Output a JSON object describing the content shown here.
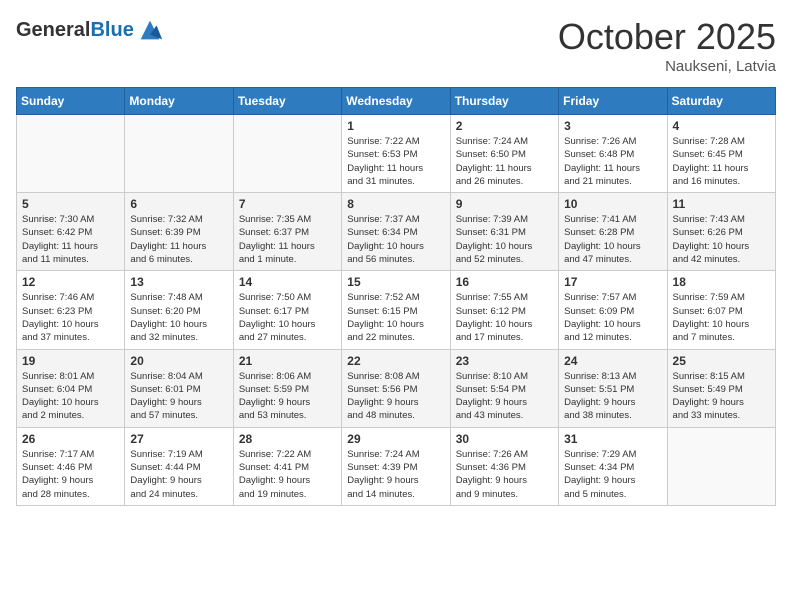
{
  "header": {
    "logo_line1": "General",
    "logo_line2": "Blue",
    "month": "October 2025",
    "location": "Naukseni, Latvia"
  },
  "weekdays": [
    "Sunday",
    "Monday",
    "Tuesday",
    "Wednesday",
    "Thursday",
    "Friday",
    "Saturday"
  ],
  "weeks": [
    [
      {
        "day": "",
        "info": ""
      },
      {
        "day": "",
        "info": ""
      },
      {
        "day": "",
        "info": ""
      },
      {
        "day": "1",
        "info": "Sunrise: 7:22 AM\nSunset: 6:53 PM\nDaylight: 11 hours\nand 31 minutes."
      },
      {
        "day": "2",
        "info": "Sunrise: 7:24 AM\nSunset: 6:50 PM\nDaylight: 11 hours\nand 26 minutes."
      },
      {
        "day": "3",
        "info": "Sunrise: 7:26 AM\nSunset: 6:48 PM\nDaylight: 11 hours\nand 21 minutes."
      },
      {
        "day": "4",
        "info": "Sunrise: 7:28 AM\nSunset: 6:45 PM\nDaylight: 11 hours\nand 16 minutes."
      }
    ],
    [
      {
        "day": "5",
        "info": "Sunrise: 7:30 AM\nSunset: 6:42 PM\nDaylight: 11 hours\nand 11 minutes."
      },
      {
        "day": "6",
        "info": "Sunrise: 7:32 AM\nSunset: 6:39 PM\nDaylight: 11 hours\nand 6 minutes."
      },
      {
        "day": "7",
        "info": "Sunrise: 7:35 AM\nSunset: 6:37 PM\nDaylight: 11 hours\nand 1 minute."
      },
      {
        "day": "8",
        "info": "Sunrise: 7:37 AM\nSunset: 6:34 PM\nDaylight: 10 hours\nand 56 minutes."
      },
      {
        "day": "9",
        "info": "Sunrise: 7:39 AM\nSunset: 6:31 PM\nDaylight: 10 hours\nand 52 minutes."
      },
      {
        "day": "10",
        "info": "Sunrise: 7:41 AM\nSunset: 6:28 PM\nDaylight: 10 hours\nand 47 minutes."
      },
      {
        "day": "11",
        "info": "Sunrise: 7:43 AM\nSunset: 6:26 PM\nDaylight: 10 hours\nand 42 minutes."
      }
    ],
    [
      {
        "day": "12",
        "info": "Sunrise: 7:46 AM\nSunset: 6:23 PM\nDaylight: 10 hours\nand 37 minutes."
      },
      {
        "day": "13",
        "info": "Sunrise: 7:48 AM\nSunset: 6:20 PM\nDaylight: 10 hours\nand 32 minutes."
      },
      {
        "day": "14",
        "info": "Sunrise: 7:50 AM\nSunset: 6:17 PM\nDaylight: 10 hours\nand 27 minutes."
      },
      {
        "day": "15",
        "info": "Sunrise: 7:52 AM\nSunset: 6:15 PM\nDaylight: 10 hours\nand 22 minutes."
      },
      {
        "day": "16",
        "info": "Sunrise: 7:55 AM\nSunset: 6:12 PM\nDaylight: 10 hours\nand 17 minutes."
      },
      {
        "day": "17",
        "info": "Sunrise: 7:57 AM\nSunset: 6:09 PM\nDaylight: 10 hours\nand 12 minutes."
      },
      {
        "day": "18",
        "info": "Sunrise: 7:59 AM\nSunset: 6:07 PM\nDaylight: 10 hours\nand 7 minutes."
      }
    ],
    [
      {
        "day": "19",
        "info": "Sunrise: 8:01 AM\nSunset: 6:04 PM\nDaylight: 10 hours\nand 2 minutes."
      },
      {
        "day": "20",
        "info": "Sunrise: 8:04 AM\nSunset: 6:01 PM\nDaylight: 9 hours\nand 57 minutes."
      },
      {
        "day": "21",
        "info": "Sunrise: 8:06 AM\nSunset: 5:59 PM\nDaylight: 9 hours\nand 53 minutes."
      },
      {
        "day": "22",
        "info": "Sunrise: 8:08 AM\nSunset: 5:56 PM\nDaylight: 9 hours\nand 48 minutes."
      },
      {
        "day": "23",
        "info": "Sunrise: 8:10 AM\nSunset: 5:54 PM\nDaylight: 9 hours\nand 43 minutes."
      },
      {
        "day": "24",
        "info": "Sunrise: 8:13 AM\nSunset: 5:51 PM\nDaylight: 9 hours\nand 38 minutes."
      },
      {
        "day": "25",
        "info": "Sunrise: 8:15 AM\nSunset: 5:49 PM\nDaylight: 9 hours\nand 33 minutes."
      }
    ],
    [
      {
        "day": "26",
        "info": "Sunrise: 7:17 AM\nSunset: 4:46 PM\nDaylight: 9 hours\nand 28 minutes."
      },
      {
        "day": "27",
        "info": "Sunrise: 7:19 AM\nSunset: 4:44 PM\nDaylight: 9 hours\nand 24 minutes."
      },
      {
        "day": "28",
        "info": "Sunrise: 7:22 AM\nSunset: 4:41 PM\nDaylight: 9 hours\nand 19 minutes."
      },
      {
        "day": "29",
        "info": "Sunrise: 7:24 AM\nSunset: 4:39 PM\nDaylight: 9 hours\nand 14 minutes."
      },
      {
        "day": "30",
        "info": "Sunrise: 7:26 AM\nSunset: 4:36 PM\nDaylight: 9 hours\nand 9 minutes."
      },
      {
        "day": "31",
        "info": "Sunrise: 7:29 AM\nSunset: 4:34 PM\nDaylight: 9 hours\nand 5 minutes."
      },
      {
        "day": "",
        "info": ""
      }
    ]
  ],
  "row_shades": [
    "white",
    "shade",
    "white",
    "shade",
    "white"
  ]
}
